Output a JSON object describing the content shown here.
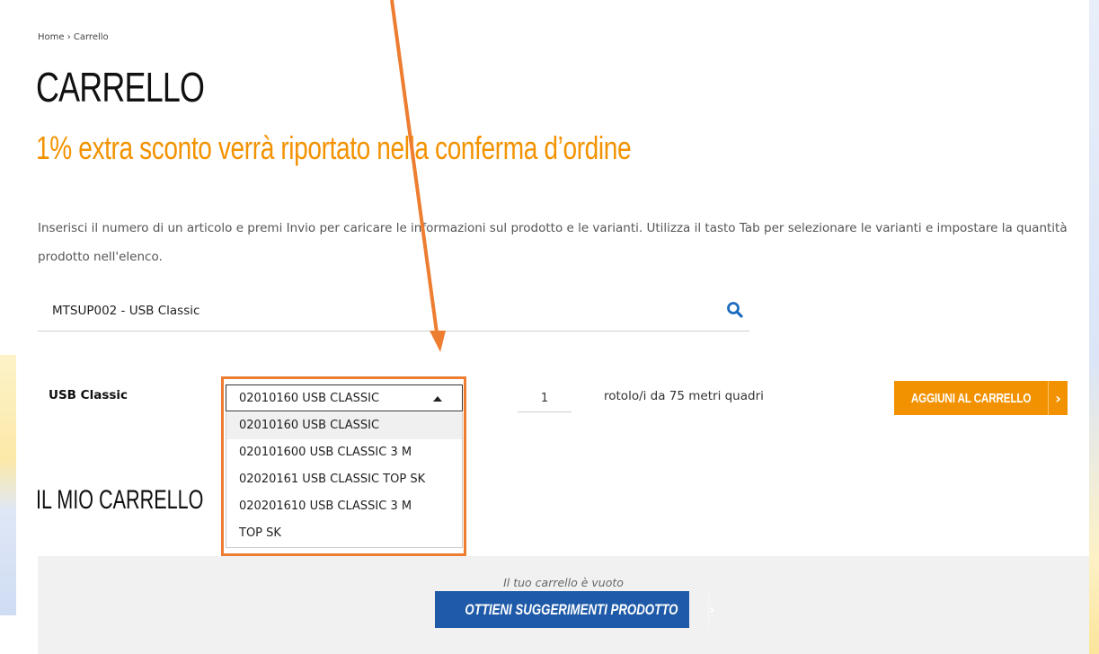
{
  "breadcrumb": "Home › Carrello",
  "page_title": "CARRELLO",
  "promo_text": "1% extra sconto verrà riportato nella conferma d’ordine",
  "instructions": "Inserisci il numero di un articolo e premi Invio per caricare le informazioni sul prodotto e le varianti. Utilizza il tasto Tab per selezionare le varianti e impostare la quantità prodotto nell'elenco.",
  "search": {
    "value": "MTSUP002 - USB Classic",
    "icon": "search-icon"
  },
  "product": {
    "name": "USB Classic",
    "selected_variant": "02010160 USB CLASSIC",
    "variants": [
      "02010160 USB CLASSIC",
      "020101600 USB CLASSIC 3 M",
      "02020161 USB CLASSIC TOP SK",
      "020201610 USB CLASSIC 3 M TOP SK"
    ],
    "quantity": "1",
    "unit": "rotolo/i da 75 metri quadri",
    "add_button": "AGGIUNI AL CARRELLO",
    "add_arrow": "›"
  },
  "cart": {
    "title": "IL MIO CARRELLO",
    "empty_text": "Il tuo carrello è vuoto",
    "suggest_button": "OTTIENI SUGGERIMENTI PRODOTTO",
    "suggest_arrow": "›"
  },
  "colors": {
    "accent_orange": "#f39200",
    "annotation_orange": "#ed7d31",
    "button_blue": "#1e5aa8"
  }
}
